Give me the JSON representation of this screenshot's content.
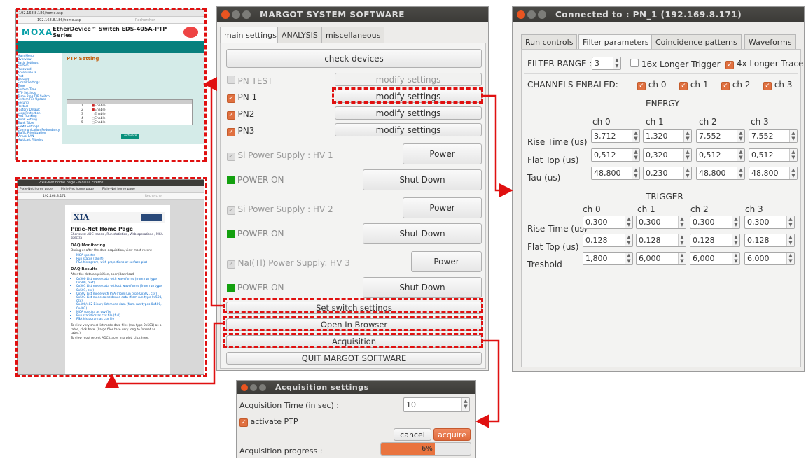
{
  "margot": {
    "title": "MARGOT SYSTEM SOFTWARE",
    "tabs": [
      "main settings",
      "ANALYSIS",
      "miscellaneous"
    ],
    "check_devices": "check devices",
    "devices": [
      {
        "name": "PN TEST",
        "btn": "modify settings"
      },
      {
        "name": "PN 1",
        "btn": "modify settings"
      },
      {
        "name": "PN2",
        "btn": "modify settings"
      },
      {
        "name": "PN3",
        "btn": "modify settings"
      }
    ],
    "supplies": [
      {
        "name": "Si Power Supply : HV 1",
        "power": "Power",
        "status": "POWER ON",
        "shut": "Shut Down"
      },
      {
        "name": "Si Power Supply : HV 2",
        "power": "Power",
        "status": "POWER ON",
        "shut": "Shut Down"
      },
      {
        "name": "NaI(Tl) Power Supply: HV 3",
        "power": "Power",
        "status": "POWER ON",
        "shut": "Shut Down"
      }
    ],
    "set_switch": "Set switch settings",
    "open_browser": "Open In Browser",
    "acquisition": "Acquisition",
    "quit": "QUIT MARGOT SOFTWARE"
  },
  "pn": {
    "title": "Connected to : PN_1 (192.169.8.171)",
    "tabs": [
      "Run controls",
      "Filter parameters",
      "Coincidence patterns",
      "Waveforms"
    ],
    "filter_range_label": "FILTER RANGE :",
    "filter_range_value": "3",
    "trig16": "16x Longer Trigger",
    "trace4": "4x Longer Trace",
    "channels_label": "CHANNELS ENBALED:",
    "channels": [
      "ch 0",
      "ch 1",
      "ch 2",
      "ch 3"
    ],
    "energy_title": "ENERGY",
    "energy_rows": [
      {
        "label": "Rise Time (us)",
        "values": [
          "3,712",
          "1,320",
          "7,552",
          "7,552"
        ]
      },
      {
        "label": "Flat Top (us)",
        "values": [
          "0,512",
          "0,320",
          "0,512",
          "0,512"
        ]
      },
      {
        "label": "Tau (us)",
        "values": [
          "48,800",
          "0,230",
          "48,800",
          "48,800"
        ]
      }
    ],
    "trigger_title": "TRIGGER",
    "trigger_rows": [
      {
        "label": "Rise Time (us)",
        "values": [
          "0,300",
          "0,300",
          "0,300",
          "0,300"
        ]
      },
      {
        "label": "Flat Top (us)",
        "values": [
          "0,128",
          "0,128",
          "0,128",
          "0,128"
        ]
      },
      {
        "label": "Treshold",
        "values": [
          "1,800",
          "6,000",
          "6,000",
          "6,000"
        ]
      }
    ]
  },
  "acq": {
    "title": "Acquisition settings",
    "time_label": "Acquisition Time (in sec) :",
    "time_value": "10",
    "ptp": "activate PTP",
    "cancel": "cancel",
    "acquire": "acquire",
    "progress_label": "Acquisition progress :",
    "progress_text": "6%",
    "progress": 0.6
  },
  "moxa": {
    "tab": "192.168.8.186/home.asp",
    "url": "192.168.8.186/home.asp",
    "search": "Rechercher",
    "brand": "MOXA",
    "product": "EtherDevice™ Switch EDS-405A-PTP Series",
    "section": "PTP Setting",
    "menu": [
      "Main Menu",
      "Overview",
      "Basic Settings",
      "System",
      "Password",
      "Accessible IP",
      "Port",
      "Network",
      "E-mail Settings",
      "Time",
      "System Time",
      "PTP Settings",
      "Turbo Ring DIP Switch",
      "System File Update",
      "Security",
      "Restart",
      "Factory Default",
      "Loop Protection",
      "Port Trunking",
      "Trunk Setting",
      "Trunk Table",
      "SNMP Settings",
      "Communication Redundancy",
      "Traffic Prioritization",
      "Virtual LAN",
      "Multicast Filtering"
    ],
    "ports": [
      "1",
      "2",
      "3",
      "4",
      "5"
    ],
    "port_enable": "Enable",
    "activate": "Activate"
  },
  "xia": {
    "title": "Pixie-Net home page - Mozilla Firefox",
    "tabs": [
      "Pixie-Net home page",
      "Pixie-Net home page",
      "Pixie-Net home page"
    ],
    "url": "192.168.8.171",
    "search": "Rechercher",
    "logo": "XIA",
    "heading": "Pixie-Net Home Page",
    "shortcuts": "Shortcuts: ADC traces , Run statistics , Web operations , MCA spectra",
    "daq_monitoring": "DAQ Monitoring",
    "daq_mon_text": "During or after the data acquisition, view most recent",
    "daq_mon_items": [
      "MCA spectra",
      "Run status (short)",
      "PSA histogram, with projections or surface plot"
    ],
    "daq_results": "DAQ Results",
    "daq_res_text": "After the data acquisition, open/download",
    "daq_res_items": [
      "0x500 List mode data with waveforms (from run type 0x500, text)",
      "0x501 List mode data without waveforms (from run type 0x501, csv)",
      "0x502 List mode with PSA (from run type 0x502, csv)",
      "0x503 List mode coincidence data (from run type 0x503, csv)",
      "0x400/402 Binary list mode data (from run types 0x400, 0x402)",
      "MCA spectra as csv file",
      "Run statistics as csv file (full)",
      "PSA histogram as csv file"
    ],
    "footer1": "To view very short list mode data files (run type 0x501) as a table, click here. (Large files take very long to format as table.)",
    "footer2": "To view most recent ADC traces in a plot, click here."
  }
}
